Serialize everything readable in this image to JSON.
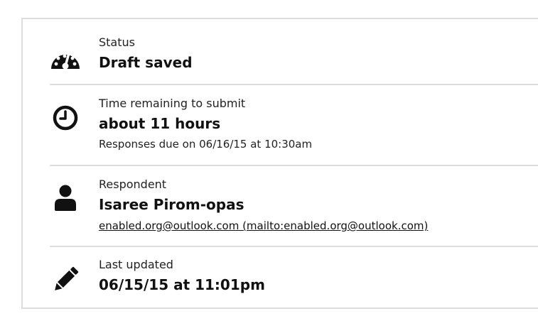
{
  "status": {
    "icon": "dashboard-gauge-icon",
    "label": "Status",
    "value": "Draft saved"
  },
  "time_remaining": {
    "icon": "clock-icon",
    "label": "Time remaining to submit",
    "value": "about 11 hours",
    "due_text": "Responses due on 06/16/15 at 10:30am"
  },
  "respondent": {
    "icon": "user-icon",
    "label": "Respondent",
    "name": "Isaree Pirom-opas",
    "email_link": "enabled.org@outlook.com (mailto:enabled.org@outlook.com)"
  },
  "last_updated": {
    "icon": "pencil-icon",
    "label": "Last updated",
    "value": "06/15/15 at 11:01pm"
  },
  "colors": {
    "text": "#111111",
    "divider": "#dddddd",
    "icon": "#111111"
  }
}
